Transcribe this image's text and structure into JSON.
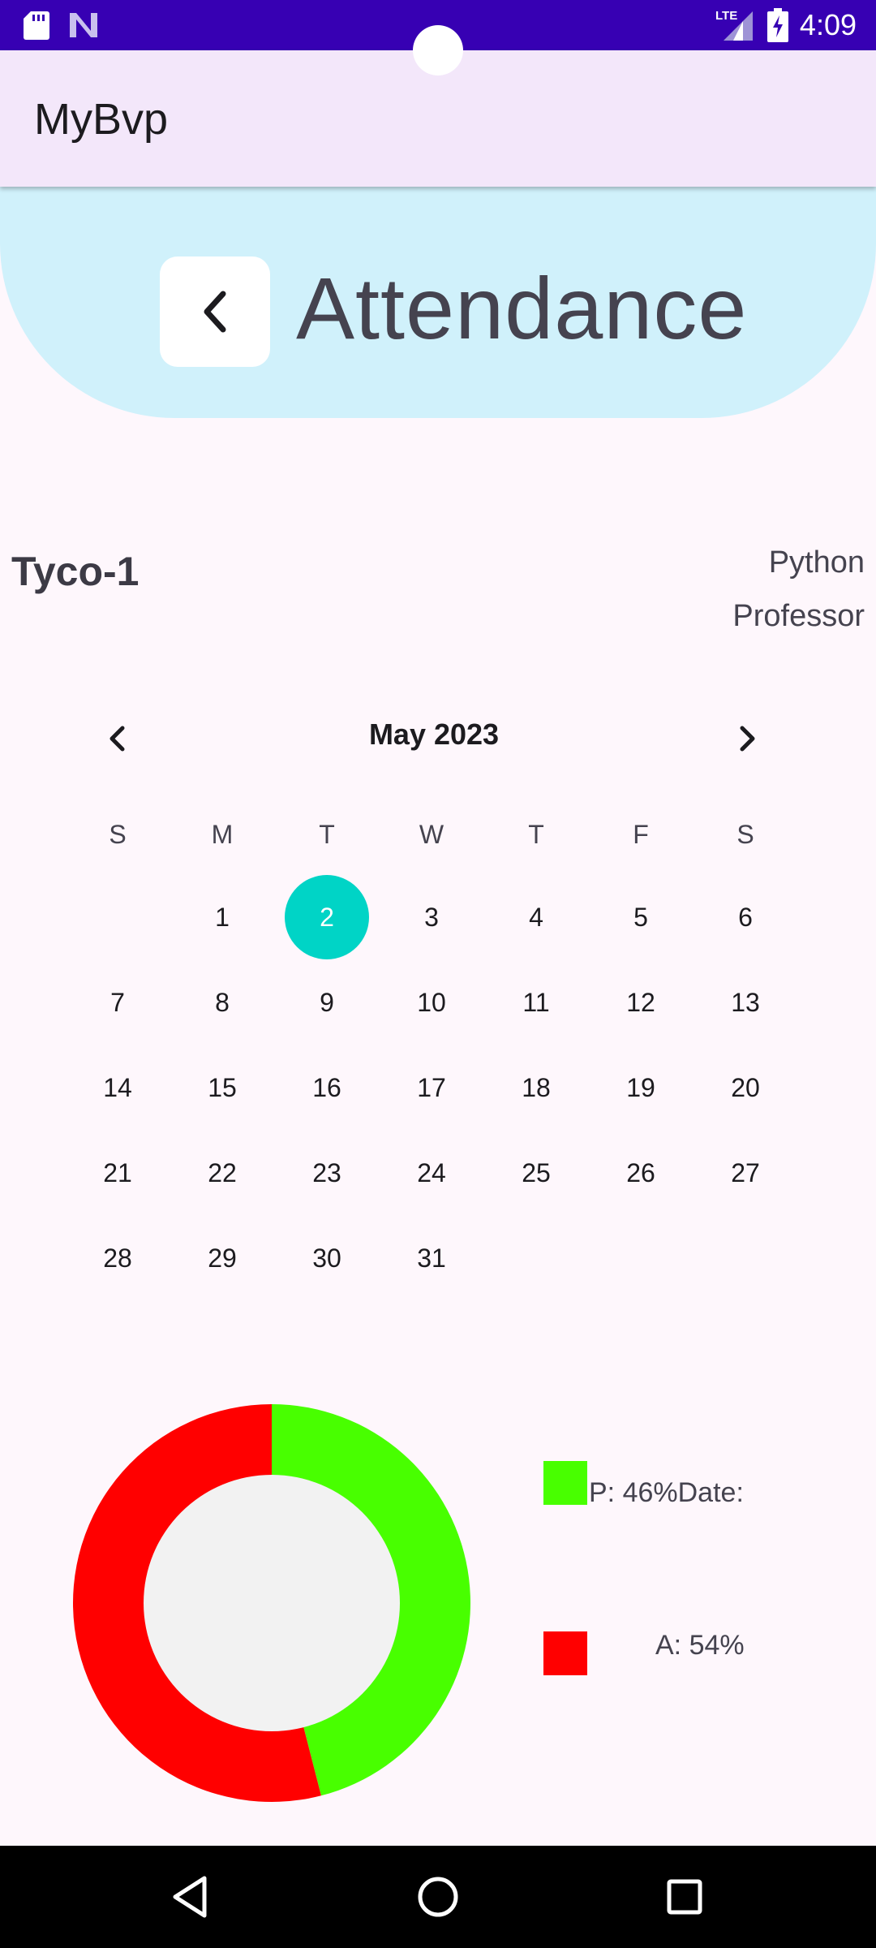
{
  "status_bar": {
    "time": "4:09",
    "network_label": "LTE",
    "icons": [
      "sd-card-icon",
      "n-logo-icon",
      "signal-icon",
      "battery-charging-icon"
    ]
  },
  "app_bar": {
    "title": "MyBvp"
  },
  "header": {
    "title": "Attendance",
    "back_icon": "chevron-left-icon"
  },
  "course": {
    "class_name": "Tyco-1",
    "subject": "Python",
    "teacher": "Professor"
  },
  "calendar": {
    "month_label": "May 2023",
    "weekdays": [
      "S",
      "M",
      "T",
      "W",
      "T",
      "F",
      "S"
    ],
    "selected_day": "2",
    "selected_color": "#00d4c6",
    "weeks": [
      [
        "",
        "1",
        "2",
        "3",
        "4",
        "5",
        "6"
      ],
      [
        "7",
        "8",
        "9",
        "10",
        "11",
        "12",
        "13"
      ],
      [
        "14",
        "15",
        "16",
        "17",
        "18",
        "19",
        "20"
      ],
      [
        "21",
        "22",
        "23",
        "24",
        "25",
        "26",
        "27"
      ],
      [
        "28",
        "29",
        "30",
        "31",
        "",
        "",
        ""
      ]
    ]
  },
  "chart_data": {
    "type": "pie",
    "labels": [
      "P",
      "A"
    ],
    "values": [
      46,
      54
    ],
    "colors": [
      "#48ff00",
      "#ff0000"
    ],
    "hole_color": "#f2f2f2",
    "legend": {
      "present": "P: 46%Date:",
      "absent": "A: 54%"
    }
  },
  "nav_bar": {
    "icons": [
      "back-triangle-icon",
      "home-circle-icon",
      "recents-square-icon"
    ]
  }
}
